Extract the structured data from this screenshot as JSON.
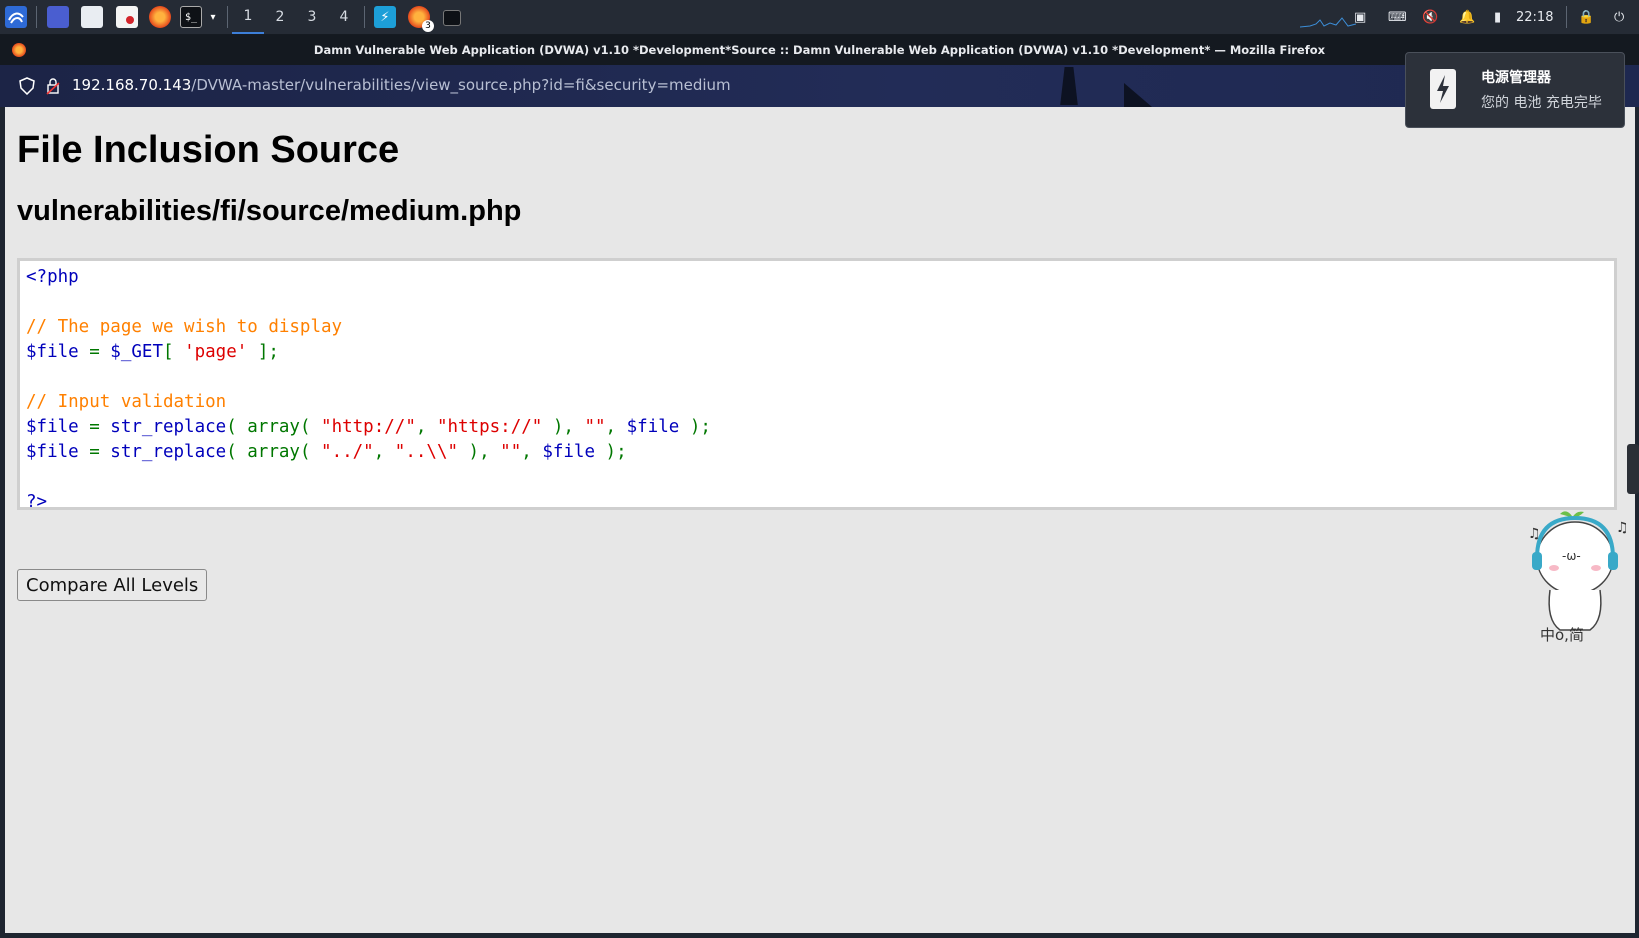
{
  "taskbar": {
    "workspaces": [
      "1",
      "2",
      "3",
      "4"
    ],
    "active_workspace": "1",
    "firefox_badge": "3",
    "clock": "22:18"
  },
  "window": {
    "title": "Damn Vulnerable Web Application (DVWA) v1.10 *Development*Source :: Damn Vulnerable Web Application (DVWA) v1.10 *Development* — Mozilla Firefox"
  },
  "urlbar": {
    "host": "192.168.70.143",
    "path": "/DVWA-master/vulnerabilities/view_source.php?id=fi&security=medium"
  },
  "page": {
    "heading": "File Inclusion Source",
    "subheading": "vulnerabilities/fi/source/medium.php",
    "code": {
      "php_open": "<?php",
      "comment1": "// The page we wish to display",
      "line_get_var": "$file",
      "line_get_eq": " = ",
      "line_get_fn": "$_GET",
      "line_get_open": "[ ",
      "line_get_str": "'page'",
      "line_get_close": " ];",
      "comment2": "// Input validation",
      "r1_var": "$file",
      "r1_eq": " = ",
      "r1_fn": "str_replace",
      "r1_open": "( array( ",
      "r1_s1": "\"http://\"",
      "r1_c1": ", ",
      "r1_s2": "\"https://\"",
      "r1_c2": " ), ",
      "r1_s3": "\"\"",
      "r1_c3": ", ",
      "r1_var2": "$file",
      "r1_end": " );",
      "r2_var": "$file",
      "r2_eq": " = ",
      "r2_fn": "str_replace",
      "r2_open": "( array( ",
      "r2_s1": "\"../\"",
      "r2_c1": ", ",
      "r2_s2": "\"..\\\\\"",
      "r2_c2": " ), ",
      "r2_s3": "\"\"",
      "r2_c3": ", ",
      "r2_var2": "$file",
      "r2_end": " );",
      "php_close": "?>"
    },
    "compare_button": "Compare All Levels"
  },
  "notification": {
    "title": "电源管理器",
    "body": "您的 电池 充电完毕"
  },
  "mascot_caption": "中o,简",
  "colors": {
    "php_keyword": "#0000bb",
    "php_comment": "#ff8000",
    "php_string": "#dd0000",
    "php_function": "#007700",
    "page_bg": "#e7e7e7"
  }
}
